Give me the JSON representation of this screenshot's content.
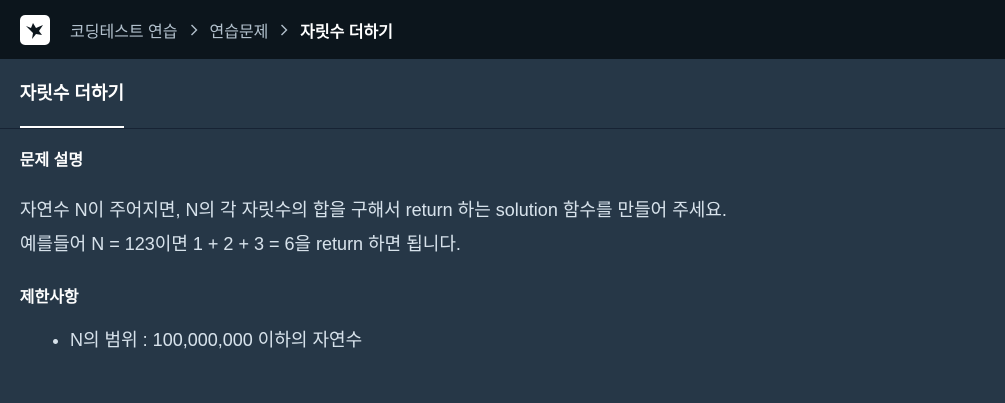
{
  "breadcrumb": {
    "items": [
      "코딩테스트 연습",
      "연습문제"
    ],
    "current": "자릿수 더하기"
  },
  "tab": {
    "label": "자릿수 더하기"
  },
  "problem": {
    "heading": "문제 설명",
    "lines": [
      "자연수 N이 주어지면, N의 각 자릿수의 합을 구해서 return 하는 solution 함수를 만들어 주세요.",
      "예를들어 N = 123이면 1 + 2 + 3 = 6을 return 하면 됩니다."
    ]
  },
  "constraints": {
    "heading": "제한사항",
    "items": [
      "N의 범위 : 100,000,000 이하의 자연수"
    ]
  },
  "icons": {
    "logo": "programmers-logo-icon",
    "separator": "chevron-right-icon"
  },
  "colors": {
    "topbar": "#0c151c",
    "background": "#263747",
    "text": "#d7e2eb"
  }
}
